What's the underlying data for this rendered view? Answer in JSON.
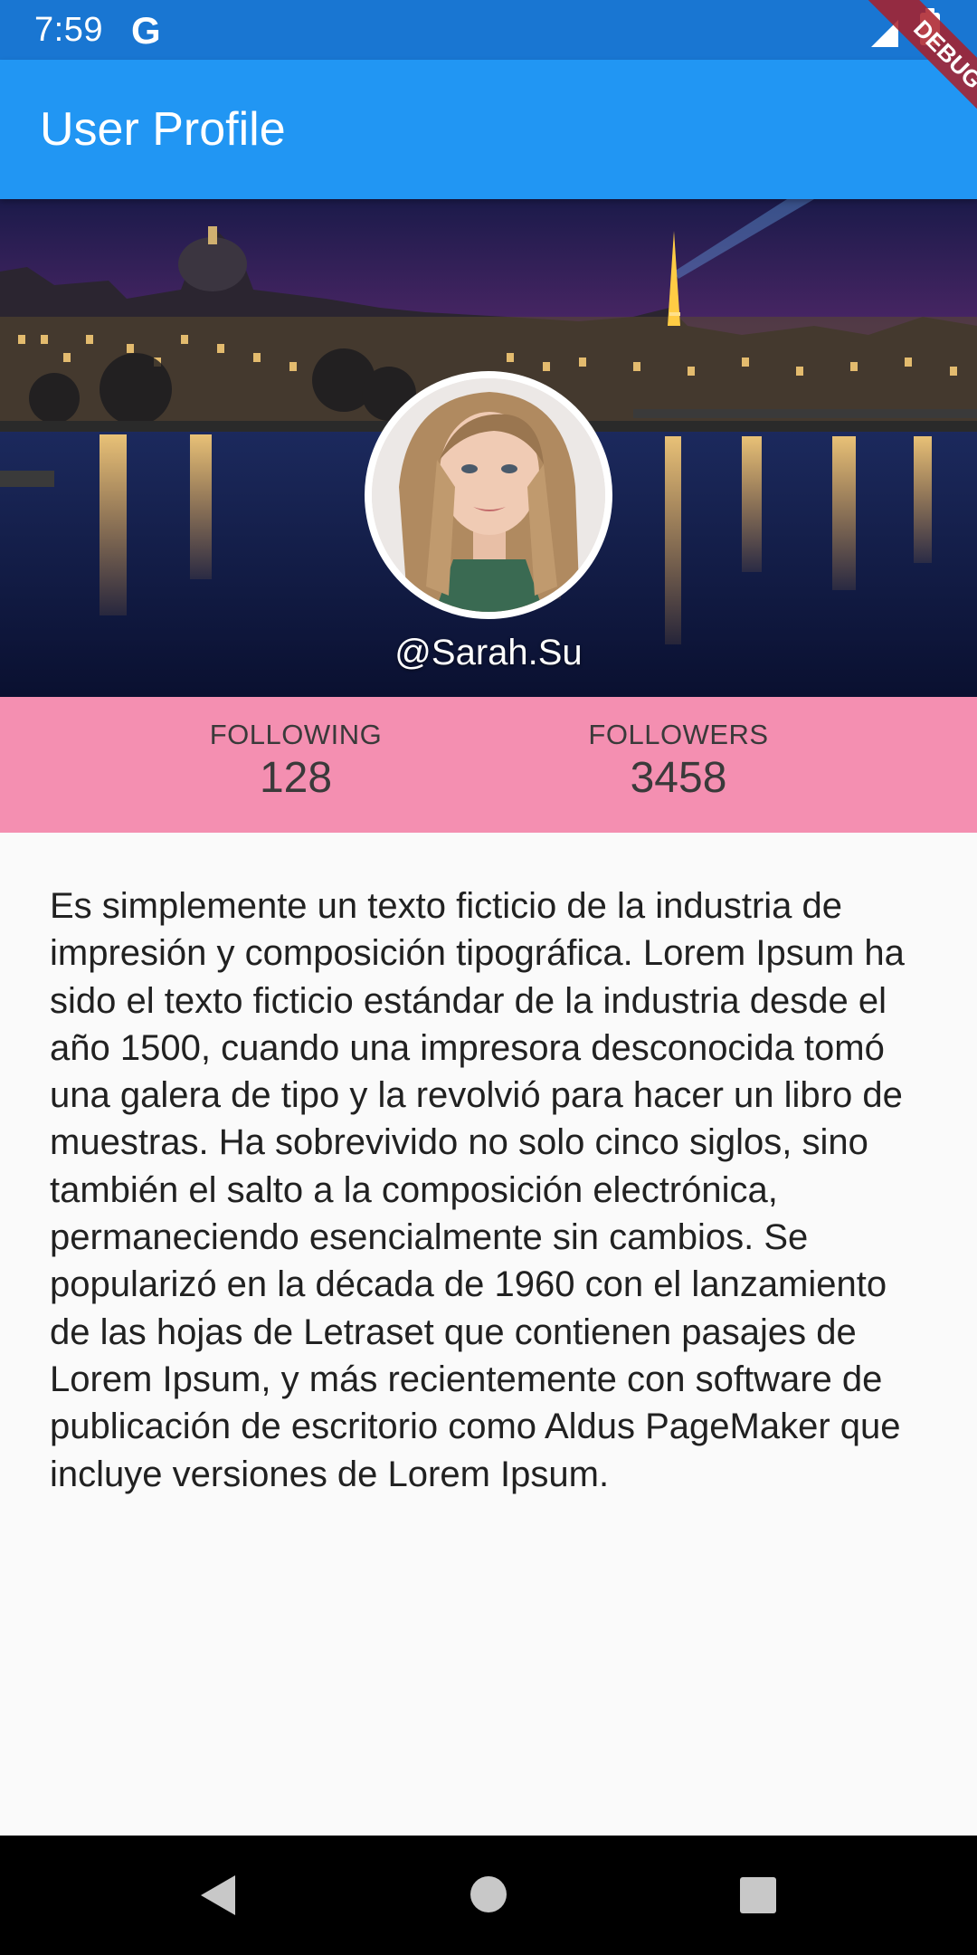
{
  "status_bar": {
    "time": "7:59",
    "g_logo": "G",
    "icons": [
      "google-icon",
      "signal-icon",
      "battery-icon"
    ]
  },
  "debug_banner": "DEBUG",
  "app_bar": {
    "title": "User Profile",
    "color": "#2196f3"
  },
  "profile": {
    "username": "@Sarah.Su",
    "cover_image": "paris-night-river-photo",
    "avatar_image": "woman-portrait-photo"
  },
  "stats": {
    "background": "#f48fb1",
    "following_label": "FOLLOWING",
    "following_value": "128",
    "followers_label": "FOLLOWERS",
    "followers_value": "3458"
  },
  "bio": "Es simplemente un texto ficticio de la industria de impresión y composición tipográfica. Lorem Ipsum ha sido el texto ficticio estándar de la industria desde el año 1500, cuando una impresora desconocida tomó una galera de tipo y la revolvió para hacer un libro de muestras. Ha sobrevivido no solo cinco siglos, sino también el salto a la composición electrónica, permaneciendo esencialmente sin cambios. Se popularizó en la década de 1960 con el lanzamiento de las hojas de Letraset que contienen pasajes de Lorem Ipsum, y más recientemente con software de publicación de escritorio como Aldus PageMaker que incluye versiones de Lorem Ipsum.",
  "nav_bar": {
    "icons": [
      "back-icon",
      "home-icon",
      "recents-icon"
    ]
  }
}
